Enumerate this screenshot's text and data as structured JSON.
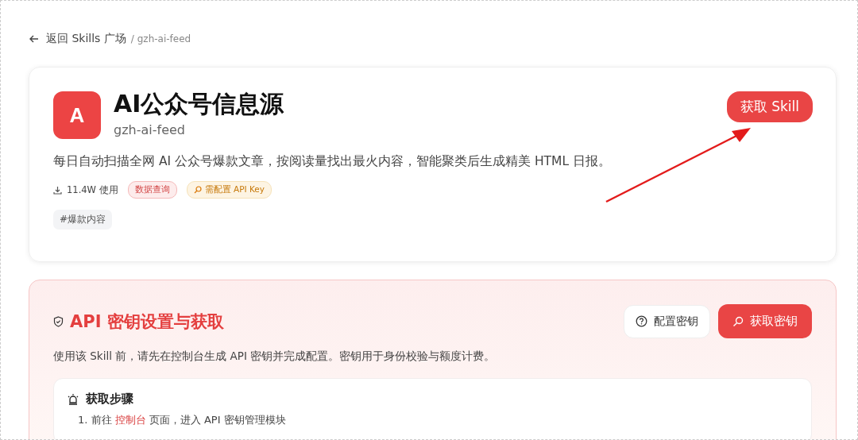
{
  "breadcrumb": {
    "back": "返回 Skills 广场",
    "current": "/ gzh-ai-feed"
  },
  "skill": {
    "avatar": "A",
    "title": "AI公众号信息源",
    "slug": "gzh-ai-feed",
    "description": "每日自动扫描全网 AI 公众号爆款文章，按阅读量找出最火内容，智能聚类后生成精美 HTML 日报。",
    "usage": "11.4W 使用",
    "badges": [
      {
        "label": "数据查询",
        "kind": "category"
      },
      {
        "label": "需配置 API Key",
        "kind": "key"
      }
    ],
    "tags": [
      "#爆款内容"
    ],
    "action": "获取 Skill"
  },
  "api_section": {
    "title": "API 密钥设置与获取",
    "description": "使用该 Skill 前，请先在控制台生成 API 密钥并完成配置。密钥用于身份校验与额度计费。",
    "buttons": [
      {
        "label": "配置密钥",
        "kind": "secondary"
      },
      {
        "label": "获取密钥",
        "kind": "primary"
      }
    ],
    "steps_title": "获取步骤",
    "steps": [
      {
        "number": "1.",
        "before": "前往",
        "link": "控制台",
        "after": "页面，进入 API 密钥管理模块"
      }
    ]
  }
}
